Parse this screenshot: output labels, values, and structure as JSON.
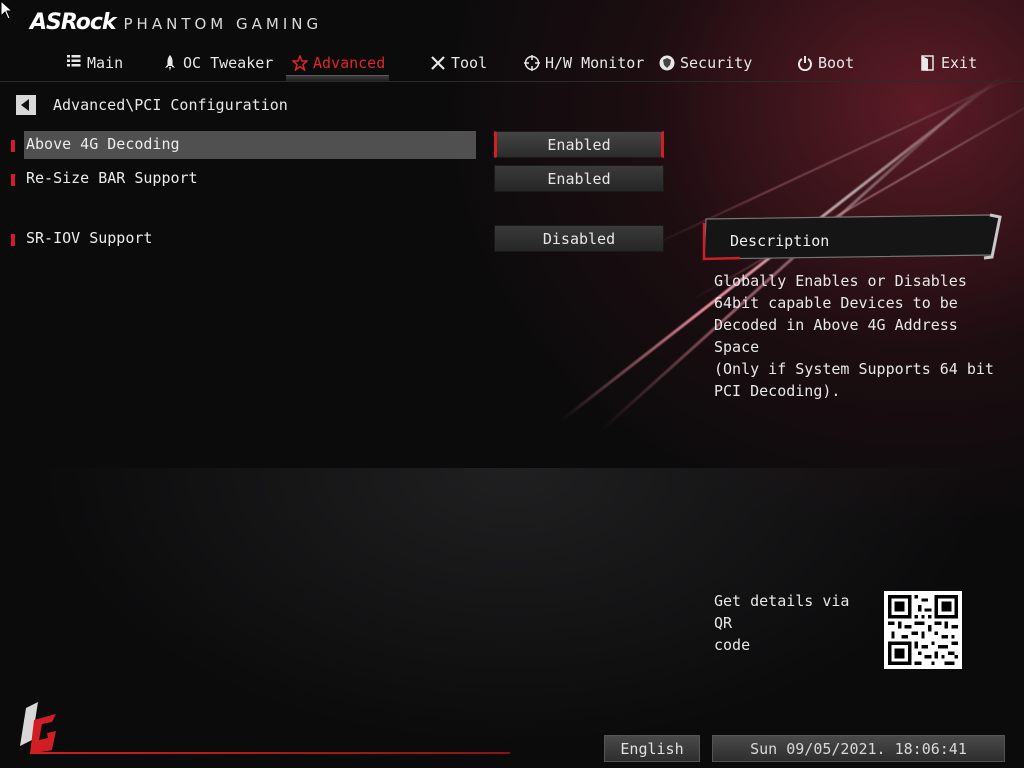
{
  "brand": {
    "logo": "ASRock",
    "sub": "PHANTOM GAMING"
  },
  "nav": [
    {
      "label": "Main",
      "icon": "list-icon",
      "active": false
    },
    {
      "label": "OC Tweaker",
      "icon": "rocket-icon",
      "active": false
    },
    {
      "label": "Advanced",
      "icon": "star-icon",
      "active": true
    },
    {
      "label": "Tool",
      "icon": "tools-icon",
      "active": false
    },
    {
      "label": "H/W Monitor",
      "icon": "crosshair-icon",
      "active": false
    },
    {
      "label": "Security",
      "icon": "shield-icon",
      "active": false
    },
    {
      "label": "Boot",
      "icon": "power-icon",
      "active": false
    },
    {
      "label": "Exit",
      "icon": "exit-icon",
      "active": false
    }
  ],
  "breadcrumb": {
    "path": "Advanced\\PCI Configuration"
  },
  "settings": [
    {
      "label": "Above 4G Decoding",
      "value": "Enabled",
      "selected": true
    },
    {
      "label": "Re-Size BAR Support",
      "value": "Enabled",
      "selected": false
    },
    {
      "label": "SR-IOV Support",
      "value": "Disabled",
      "selected": false
    }
  ],
  "description": {
    "title": "Description",
    "lines": [
      "Globally Enables or Disables",
      "64bit capable Devices to be",
      "Decoded in Above 4G Address Space",
      "(Only if System Supports 64 bit",
      "PCI Decoding)."
    ]
  },
  "qr": {
    "lines": [
      "Get details via QR",
      "code"
    ]
  },
  "status": {
    "language": "English",
    "datetime": "Sun 09/05/2021. 18:06:41"
  },
  "colors": {
    "accent": "#d01e24",
    "background": "#0b0b0c",
    "selected_row": "#505050"
  }
}
